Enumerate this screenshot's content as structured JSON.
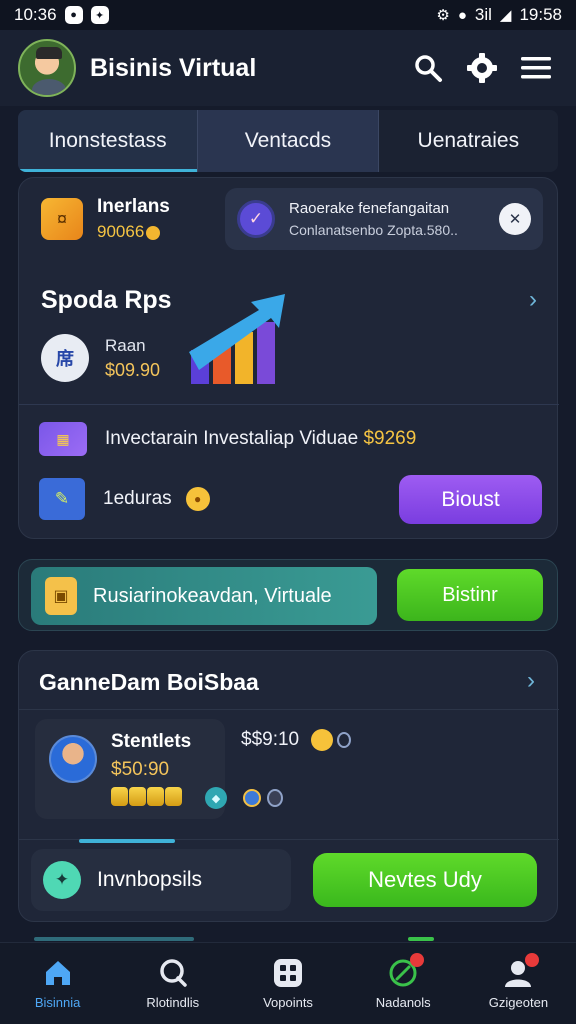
{
  "status_bar": {
    "time_left": "10:36",
    "time_right": "19:58",
    "signal_text": "3il"
  },
  "header": {
    "app_title": "Bisinis Virtual",
    "search_icon": "search-icon",
    "settings_icon": "gear-icon",
    "menu_icon": "hamburger-menu-icon"
  },
  "tabs": [
    {
      "label": "Inonstestass"
    },
    {
      "label": "Ventacds"
    },
    {
      "label": "Uenatraies"
    }
  ],
  "wallet": {
    "name": "Inerlans",
    "amount": "90066"
  },
  "notification": {
    "line1": "Raoerake fenefangaitan",
    "line2": "Conlanatsenbo Zopta.580.."
  },
  "speed_section": {
    "title": "Spoda Rps",
    "rank_badge": "席",
    "rank_label": "Raan",
    "rank_value": "$09.90"
  },
  "investment": {
    "label": "Invectarain Investaliap Viduae",
    "value": "$9269"
  },
  "lectures": {
    "label": "1eduras",
    "boost_label": "Bioust"
  },
  "banner": {
    "text": "Rusiarinokeavdan, Virtuale",
    "button_label": "Bistinr"
  },
  "gameboard": {
    "title": "GanneDam BoiSbaa",
    "player_name": "Stentlets",
    "player_value": "$50:90",
    "stat_value": "$$9:10"
  },
  "actions": {
    "deposit_label": "Invnbopsils",
    "primary_label": "Nevtes Udy"
  },
  "bottom_nav": [
    {
      "label": "Bisinnia",
      "icon": "home-icon"
    },
    {
      "label": "Rlotindlis",
      "icon": "chat-search-icon"
    },
    {
      "label": "Vopoints",
      "icon": "grid-icon"
    },
    {
      "label": "Nadanols",
      "icon": "target-icon"
    },
    {
      "label": "Gzigeoten",
      "icon": "profile-icon"
    }
  ],
  "colors": {
    "accent_blue": "#3fb2d8",
    "accent_purple": "#8b4fe8",
    "accent_green": "#4fd02a",
    "coin_gold": "#f5c443"
  }
}
